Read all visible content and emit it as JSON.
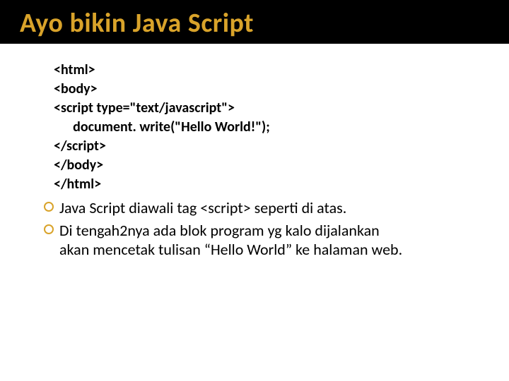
{
  "title": "Ayo bikin Java Script",
  "code": {
    "l1": "<html>",
    "l2": "<body>",
    "l3": "<script type=\"text/javascript\">",
    "l4": "      document. write(\"Hello World!\");",
    "l5": "</script>",
    "l6": "</body>",
    "l7": "</html>"
  },
  "bullets": {
    "b1": "Java Script diawali tag <script> seperti di atas.",
    "b2a": "Di tengah2nya ada blok program yg kalo dijalankan",
    "b2b": "akan mencetak tulisan “Hello World” ke halaman web."
  }
}
